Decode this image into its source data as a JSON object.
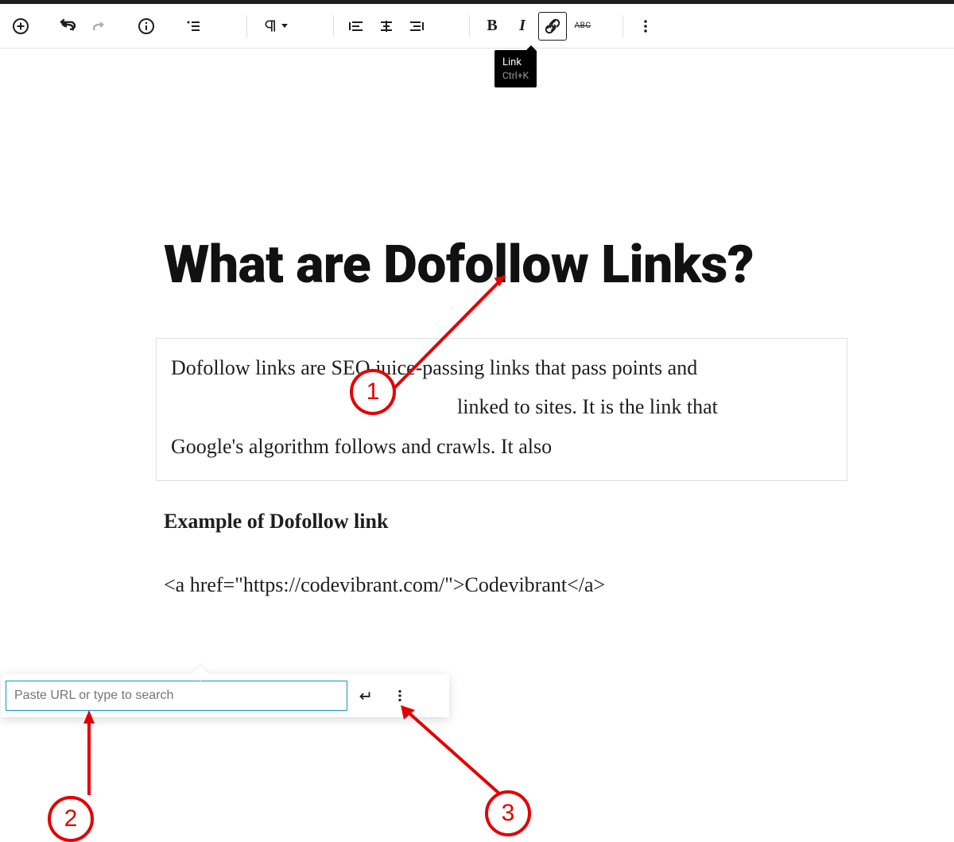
{
  "tooltip": {
    "title": "Link",
    "shortcut": "Ctrl+K"
  },
  "toolbar": {
    "strike_label": "ABC"
  },
  "heading": "What are Dofollow Links?",
  "paragraph": {
    "line1": "Dofollow links are SEO juice-passing links that pass points and",
    "line2": "linked to sites. It is the link that",
    "line3": "Google's algorithm follows and crawls. It also"
  },
  "subheading": "Example of Dofollow link",
  "code": "<a href=\"https://codevibrant.com/\">Codevibrant</a>",
  "link_popover": {
    "placeholder": "Paste URL or type to search"
  },
  "annotations": {
    "one": "1",
    "two": "2",
    "three": "3"
  }
}
